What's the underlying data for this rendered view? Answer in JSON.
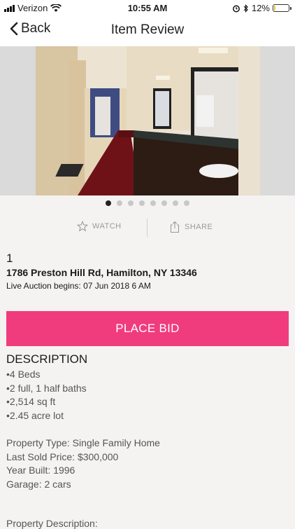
{
  "status_bar": {
    "carrier": "Verizon",
    "time": "10:55 AM",
    "battery": "12%",
    "battery_level": 0.12
  },
  "nav": {
    "back_label": "Back",
    "title": "Item Review"
  },
  "gallery": {
    "photo_count": 8,
    "active_index": 0
  },
  "actions": {
    "watch_label": "WATCH",
    "share_label": "SHARE"
  },
  "item": {
    "lot_number": "1",
    "address": "1786 Preston Hill Rd, Hamilton, NY 13346",
    "auction_info": "Live Auction begins: 07 Jun 2018 6 AM"
  },
  "bid_button": {
    "label": "PLACE BID",
    "color": "#f03c7c"
  },
  "description": {
    "heading": "DESCRIPTION",
    "bullets": [
      "4 Beds",
      "2 full, 1 half baths",
      "2,514 sq ft",
      "2.45 acre lot"
    ],
    "facts": [
      "Property Type: Single Family Home",
      "Last Sold Price: $300,000",
      "Year Built: 1996",
      "Garage: 2 cars"
    ],
    "property_description_label": "Property Description:"
  }
}
